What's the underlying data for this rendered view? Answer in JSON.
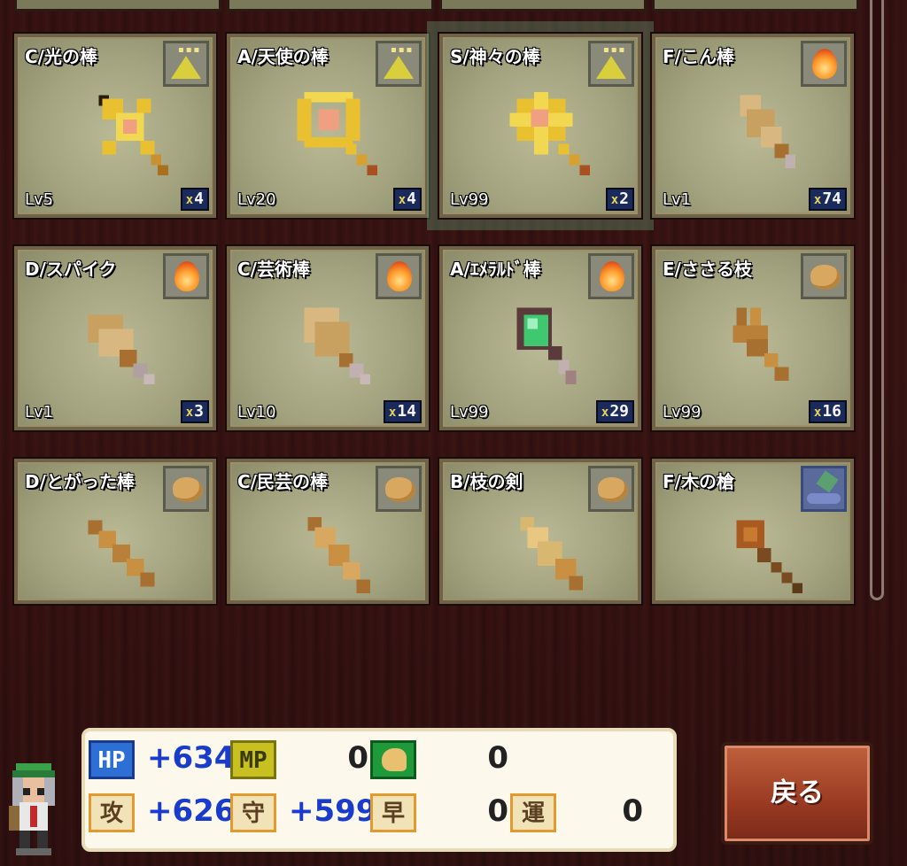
{
  "items": [
    {
      "name": "C/光の棒",
      "level": "Lv5",
      "count": "4",
      "element": "earth",
      "weapon": "light-rod"
    },
    {
      "name": "A/天使の棒",
      "level": "Lv20",
      "count": "4",
      "element": "earth",
      "weapon": "angel-rod"
    },
    {
      "name": "S/神々の棒",
      "level": "Lv99",
      "count": "2",
      "element": "earth",
      "weapon": "gods-rod",
      "selected": true
    },
    {
      "name": "F/こん棒",
      "level": "Lv1",
      "count": "74",
      "element": "fire",
      "weapon": "club"
    },
    {
      "name": "D/スパイク",
      "level": "Lv1",
      "count": "3",
      "element": "fire",
      "weapon": "spike"
    },
    {
      "name": "C/芸術棒",
      "level": "Lv10",
      "count": "14",
      "element": "fire",
      "weapon": "art-rod"
    },
    {
      "name": "A/ｴﾒﾗﾙﾄﾞ棒",
      "level": "Lv99",
      "count": "29",
      "element": "fire",
      "weapon": "emerald-rod"
    },
    {
      "name": "E/ささる枝",
      "level": "Lv99",
      "count": "16",
      "element": "wind",
      "weapon": "thorn-branch"
    },
    {
      "name": "D/とがった棒",
      "level": "",
      "count": "",
      "element": "wind",
      "weapon": "sharp-rod"
    },
    {
      "name": "C/民芸の棒",
      "level": "",
      "count": "",
      "element": "wind",
      "weapon": "folk-rod"
    },
    {
      "name": "B/枝の剣",
      "level": "",
      "count": "",
      "element": "wind",
      "weapon": "branch-sword"
    },
    {
      "name": "F/木の槍",
      "level": "",
      "count": "",
      "element": "water",
      "weapon": "wood-spear"
    }
  ],
  "count_prefix": "x",
  "stats": {
    "hp": {
      "icon": "HP",
      "value": "+634"
    },
    "mp": {
      "icon": "MP",
      "value": "0"
    },
    "str": {
      "icon": "strength",
      "value": "0"
    },
    "atk": {
      "icon": "攻",
      "value": "+626"
    },
    "def": {
      "icon": "守",
      "value": "+599"
    },
    "spd": {
      "icon": "早",
      "value": "0"
    },
    "luck": {
      "icon": "運",
      "value": "0"
    }
  },
  "back_button": "戻る",
  "colors": {
    "plus": "#1a3ccc",
    "card": "#a3a37f",
    "button": "#9a3a22"
  }
}
